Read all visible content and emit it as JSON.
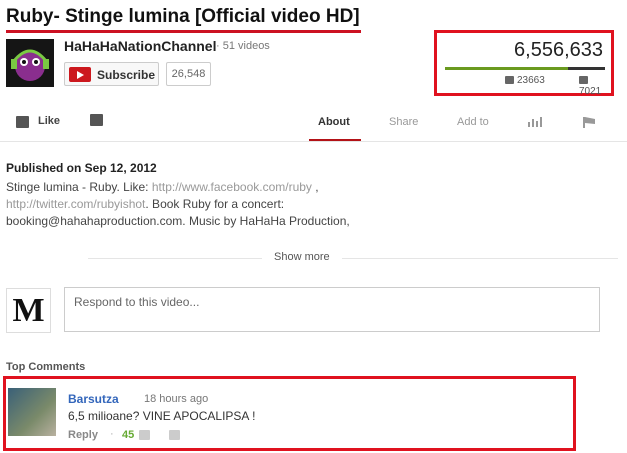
{
  "video": {
    "title": "Ruby- Stinge lumina [Official video HD]"
  },
  "channel": {
    "name": "HaHaHaNationChannel",
    "video_count": "· 51 videos",
    "subscribe_label": "Subscribe",
    "subscriber_count": "26,548"
  },
  "stats": {
    "views": "6,556,633",
    "likes": "23663",
    "dislikes": "7021",
    "like_ratio": 0.77
  },
  "actions": {
    "like_label": "Like",
    "tabs": [
      "About",
      "Share",
      "Add to"
    ]
  },
  "about": {
    "published": "Published on Sep 12, 2012",
    "desc_1": "Stinge lumina - Ruby. Like: ",
    "link_1": "http://www.facebook.com/ruby",
    "desc_2": " ,",
    "link_2": "http://twitter.com/rubyishot",
    "desc_3": ". Book Ruby for a concert: booking@hahahaproduction.com. Music by HaHaHa Production,",
    "show_more": "Show more"
  },
  "comment_input": {
    "placeholder": "Respond to this video..."
  },
  "comments": {
    "section_title": "Top Comments",
    "items": [
      {
        "user": "Barsutza",
        "time": "18 hours ago",
        "text": "6,5 milioane? VINE APOCALIPSA !",
        "reply_label": "Reply",
        "score": "45"
      }
    ]
  },
  "colors": {
    "highlight": "#e0121f",
    "accent": "#cc181e",
    "like_bar": "#6a9a1f"
  },
  "user_avatar_letter": "M"
}
